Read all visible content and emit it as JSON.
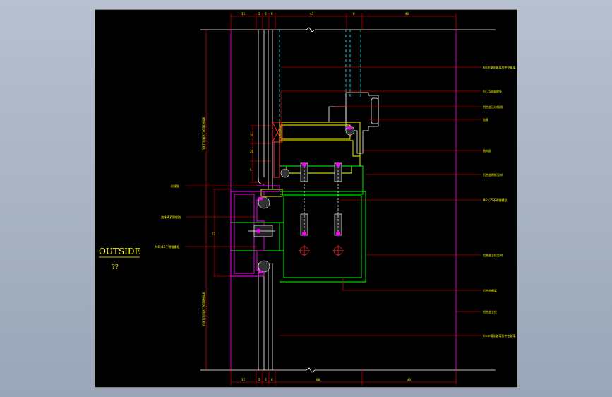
{
  "drawing": {
    "outside_label": "OUTSIDE",
    "outside_sub": "??",
    "colors": {
      "background": "#000000",
      "frame": "#ffffff",
      "callout": "#ff0000",
      "dimension": "#ff0000",
      "text": "#ffff00",
      "profile_green": "#00ff00",
      "profile_magenta": "#ff00ff",
      "glass_cyan": "#00ffff",
      "fill_red": "#ff3333"
    },
    "dims_top": [
      "15",
      "5",
      "6",
      "6",
      "45",
      "8",
      "40"
    ],
    "dims_bottom": [
      "15",
      "5",
      "6",
      "6",
      "68",
      "40"
    ],
    "dims_left_vertical": [
      "20",
      "20",
      "5"
    ],
    "dims_left_text": [
      "52"
    ],
    "side_text_upper": "ISS TO NEXT ASSEMBLE",
    "side_text_lower": "ISS TO NEXT ASSEMBLE",
    "callouts_right": [
      "6mm钢化玻璃及中空玻璃",
      "9×15双面胶条",
      "铝合金压块插销",
      "胶条",
      "结构胶",
      "铝合金附框型材",
      "M6×25不锈钢螺栓",
      "铝合金立柱型材",
      "铝合金横梁",
      "铝合金立柱",
      "6mm钢化玻璃及中空玻璃"
    ],
    "callouts_left": [
      "耐候胶",
      "泡沫棒及耐候胶",
      "M6×12不锈钢螺栓"
    ]
  }
}
